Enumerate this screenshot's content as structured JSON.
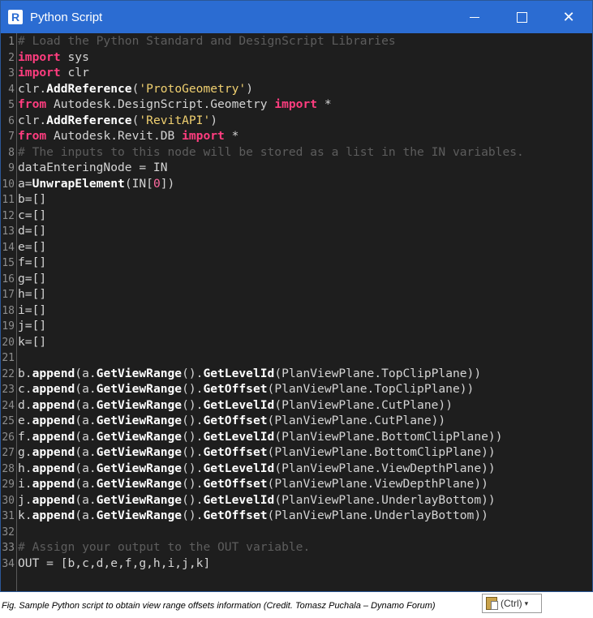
{
  "window": {
    "title": "Python Script"
  },
  "controls": {
    "minimize": "minimize",
    "maximize": "maximize",
    "close": "✕"
  },
  "lines": [
    [
      [
        "cm",
        "# Load the Python Standard and DesignScript Libraries"
      ]
    ],
    [
      [
        "kw",
        "import"
      ],
      [
        "id",
        " sys"
      ]
    ],
    [
      [
        "kw",
        "import"
      ],
      [
        "id",
        " clr"
      ]
    ],
    [
      [
        "id",
        "clr."
      ],
      [
        "fn",
        "AddReference"
      ],
      [
        "id",
        "("
      ],
      [
        "str",
        "'ProtoGeometry'"
      ],
      [
        "id",
        ")"
      ]
    ],
    [
      [
        "kw",
        "from"
      ],
      [
        "id",
        " Autodesk.DesignScript.Geometry "
      ],
      [
        "kw",
        "import"
      ],
      [
        "id",
        " *"
      ]
    ],
    [
      [
        "id",
        "clr."
      ],
      [
        "fn",
        "AddReference"
      ],
      [
        "id",
        "("
      ],
      [
        "str",
        "'RevitAPI'"
      ],
      [
        "id",
        ")"
      ]
    ],
    [
      [
        "kw",
        "from"
      ],
      [
        "id",
        " Autodesk.Revit.DB "
      ],
      [
        "kw",
        "import"
      ],
      [
        "id",
        " *"
      ]
    ],
    [
      [
        "cm",
        "# The inputs to this node will be stored as a list in the IN variables."
      ]
    ],
    [
      [
        "id",
        "dataEnteringNode = IN"
      ]
    ],
    [
      [
        "id",
        "a="
      ],
      [
        "fn",
        "UnwrapElement"
      ],
      [
        "id",
        "(IN["
      ],
      [
        "num",
        "0"
      ],
      [
        "id",
        "])"
      ]
    ],
    [
      [
        "id",
        "b=[]"
      ]
    ],
    [
      [
        "id",
        "c=[]"
      ]
    ],
    [
      [
        "id",
        "d=[]"
      ]
    ],
    [
      [
        "id",
        "e=[]"
      ]
    ],
    [
      [
        "id",
        "f=[]"
      ]
    ],
    [
      [
        "id",
        "g=[]"
      ]
    ],
    [
      [
        "id",
        "h=[]"
      ]
    ],
    [
      [
        "id",
        "i=[]"
      ]
    ],
    [
      [
        "id",
        "j=[]"
      ]
    ],
    [
      [
        "id",
        "k=[]"
      ]
    ],
    [],
    [
      [
        "id",
        "b."
      ],
      [
        "fn",
        "append"
      ],
      [
        "id",
        "(a."
      ],
      [
        "fn",
        "GetViewRange"
      ],
      [
        "id",
        "()."
      ],
      [
        "fn",
        "GetLevelId"
      ],
      [
        "id",
        "(PlanViewPlane.TopClipPlane))"
      ]
    ],
    [
      [
        "id",
        "c."
      ],
      [
        "fn",
        "append"
      ],
      [
        "id",
        "(a."
      ],
      [
        "fn",
        "GetViewRange"
      ],
      [
        "id",
        "()."
      ],
      [
        "fn",
        "GetOffset"
      ],
      [
        "id",
        "(PlanViewPlane.TopClipPlane))"
      ]
    ],
    [
      [
        "id",
        "d."
      ],
      [
        "fn",
        "append"
      ],
      [
        "id",
        "(a."
      ],
      [
        "fn",
        "GetViewRange"
      ],
      [
        "id",
        "()."
      ],
      [
        "fn",
        "GetLevelId"
      ],
      [
        "id",
        "(PlanViewPlane.CutPlane))"
      ]
    ],
    [
      [
        "id",
        "e."
      ],
      [
        "fn",
        "append"
      ],
      [
        "id",
        "(a."
      ],
      [
        "fn",
        "GetViewRange"
      ],
      [
        "id",
        "()."
      ],
      [
        "fn",
        "GetOffset"
      ],
      [
        "id",
        "(PlanViewPlane.CutPlane))"
      ]
    ],
    [
      [
        "id",
        "f."
      ],
      [
        "fn",
        "append"
      ],
      [
        "id",
        "(a."
      ],
      [
        "fn",
        "GetViewRange"
      ],
      [
        "id",
        "()."
      ],
      [
        "fn",
        "GetLevelId"
      ],
      [
        "id",
        "(PlanViewPlane.BottomClipPlane))"
      ]
    ],
    [
      [
        "id",
        "g."
      ],
      [
        "fn",
        "append"
      ],
      [
        "id",
        "(a."
      ],
      [
        "fn",
        "GetViewRange"
      ],
      [
        "id",
        "()."
      ],
      [
        "fn",
        "GetOffset"
      ],
      [
        "id",
        "(PlanViewPlane.BottomClipPlane))"
      ]
    ],
    [
      [
        "id",
        "h."
      ],
      [
        "fn",
        "append"
      ],
      [
        "id",
        "(a."
      ],
      [
        "fn",
        "GetViewRange"
      ],
      [
        "id",
        "()."
      ],
      [
        "fn",
        "GetLevelId"
      ],
      [
        "id",
        "(PlanViewPlane.ViewDepthPlane))"
      ]
    ],
    [
      [
        "id",
        "i."
      ],
      [
        "fn",
        "append"
      ],
      [
        "id",
        "(a."
      ],
      [
        "fn",
        "GetViewRange"
      ],
      [
        "id",
        "()."
      ],
      [
        "fn",
        "GetOffset"
      ],
      [
        "id",
        "(PlanViewPlane.ViewDepthPlane))"
      ]
    ],
    [
      [
        "id",
        "j."
      ],
      [
        "fn",
        "append"
      ],
      [
        "id",
        "(a."
      ],
      [
        "fn",
        "GetViewRange"
      ],
      [
        "id",
        "()."
      ],
      [
        "fn",
        "GetLevelId"
      ],
      [
        "id",
        "(PlanViewPlane.UnderlayBottom))"
      ]
    ],
    [
      [
        "id",
        "k."
      ],
      [
        "fn",
        "append"
      ],
      [
        "id",
        "(a."
      ],
      [
        "fn",
        "GetViewRange"
      ],
      [
        "id",
        "()."
      ],
      [
        "fn",
        "GetOffset"
      ],
      [
        "id",
        "(PlanViewPlane.UnderlayBottom))"
      ]
    ],
    [],
    [
      [
        "cm",
        "# Assign your output to the OUT variable."
      ]
    ],
    [
      [
        "id",
        "OUT = [b,c,d,e,f,g,h,i,j,k]"
      ]
    ]
  ],
  "caption": "Fig. Sample Python script to obtain view range offsets information (Credit. Tomasz Puchala – Dynamo Forum)",
  "paste_options": {
    "label": "(Ctrl)",
    "caret": "▾",
    "icon": "clipboard-icon"
  },
  "colors": {
    "titlebar": "#2b6cd2",
    "editor_bg": "#1e1e1e",
    "keyword": "#ff3d7f",
    "comment": "#5d5d5d",
    "string": "#f0d070"
  }
}
